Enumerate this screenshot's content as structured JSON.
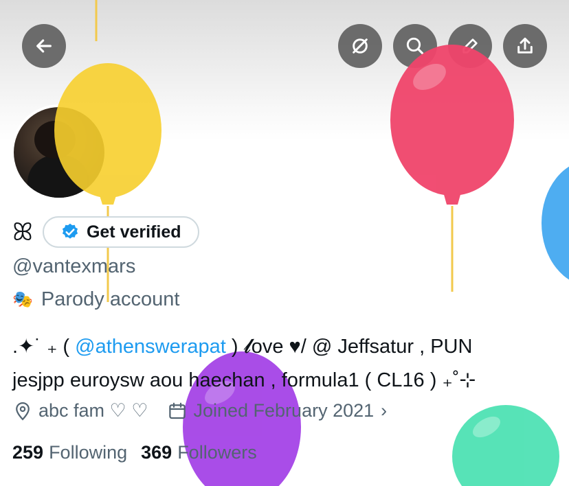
{
  "header": {
    "back_icon": "arrow-left-icon",
    "buttons": [
      "pin-off-icon",
      "search-icon",
      "edit-pencil-icon",
      "share-icon"
    ]
  },
  "profile": {
    "name_glyph": "ꕤ",
    "get_verified_label": "Get verified",
    "handle": "@vantexmars",
    "parody_label": "Parody account",
    "bio": {
      "line1_prefix": ".✦˙ ₊ ( ",
      "mention": "@athenswerapat",
      "line1_suffix": " ) 𝓵ove ♥︎/ @ Jeffsatur , PUN",
      "line2": "jesjpp euroysw aou haechan , formula1 ( CL16 ) ₊˚⊹"
    },
    "location": "abc fam ♡ ♡",
    "joined": "Joined February 2021",
    "following_count": "259",
    "following_label": "Following",
    "followers_count": "369",
    "followers_label": "Followers"
  },
  "colors": {
    "accent": "#1d9bf0",
    "secondary_text": "#536471",
    "balloon_yellow": "#f7cf2e",
    "balloon_red": "#f0456b",
    "balloon_purple": "#a23ee6",
    "balloon_green": "#4fe2b4",
    "balloon_blue": "#45a9f0"
  }
}
